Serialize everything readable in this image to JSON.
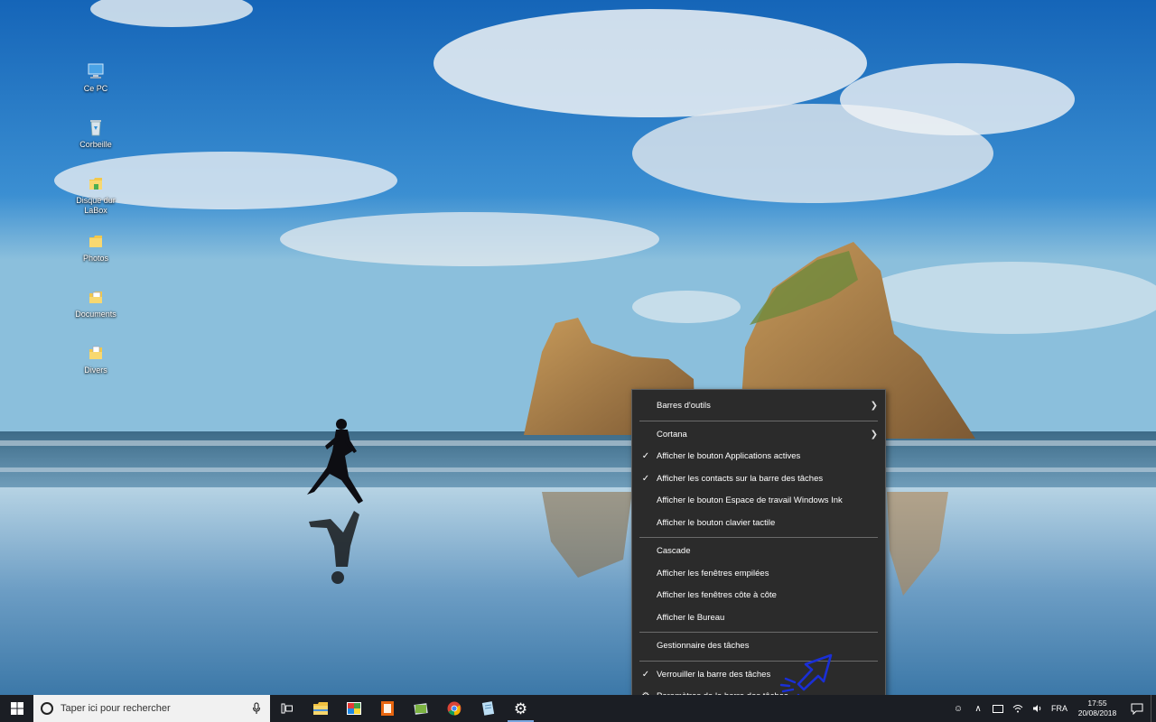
{
  "desktop": {
    "icons": [
      {
        "label": "Ce PC",
        "icon": "computer-icon"
      },
      {
        "label": "Corbeille",
        "icon": "recycle-bin-icon"
      },
      {
        "label": "Disque dur\nLaBox",
        "icon": "folder-icon"
      },
      {
        "label": "Photos",
        "icon": "folder-icon"
      },
      {
        "label": "Documents",
        "icon": "documents-folder-icon"
      },
      {
        "label": "Divers",
        "icon": "folder-icon"
      }
    ]
  },
  "context_menu": {
    "groups": [
      [
        {
          "label": "Barres d'outils",
          "checked": false,
          "submenu": true
        },
        {
          "label": "Cortana",
          "checked": false,
          "submenu": true
        },
        {
          "label": "Afficher le bouton Applications actives",
          "checked": true
        },
        {
          "label": "Afficher les contacts sur la barre des tâches",
          "checked": true
        },
        {
          "label": "Afficher le bouton Espace de travail Windows Ink",
          "checked": false
        },
        {
          "label": "Afficher le bouton clavier tactile",
          "checked": false
        }
      ],
      [
        {
          "label": "Cascade"
        },
        {
          "label": "Afficher les fenêtres empilées"
        },
        {
          "label": "Afficher les fenêtres côte à côte"
        },
        {
          "label": "Afficher le Bureau"
        }
      ],
      [
        {
          "label": "Gestionnaire des tâches"
        }
      ],
      [
        {
          "label": "Verrouiller la barre des tâches",
          "checked": true
        },
        {
          "label": "Paramètres de la barre des tâches",
          "icon": "gear-icon"
        }
      ]
    ]
  },
  "taskbar": {
    "search_placeholder": "Taper ici pour rechercher",
    "pinned_apps": [
      {
        "name": "task-view-button",
        "icon": "task-view-icon"
      },
      {
        "name": "file-explorer-button",
        "icon": "folder-icon"
      },
      {
        "name": "paint-app-button",
        "icon": "paint-icon"
      },
      {
        "name": "office-app-button",
        "icon": "office-icon"
      },
      {
        "name": "photos-app-button",
        "icon": "photos-icon"
      },
      {
        "name": "chrome-button",
        "icon": "chrome-icon"
      },
      {
        "name": "notepad-app-button",
        "icon": "notepad-icon"
      },
      {
        "name": "settings-app-button",
        "icon": "gear-icon",
        "active": true
      }
    ],
    "tray": {
      "language": "FRA",
      "time": "17:55",
      "date": "20/08/2018"
    }
  },
  "colors": {
    "menu_bg": "#2b2b2b",
    "taskbar_bg": "#1b1e24",
    "annotation_blue": "#1a2fd6"
  }
}
